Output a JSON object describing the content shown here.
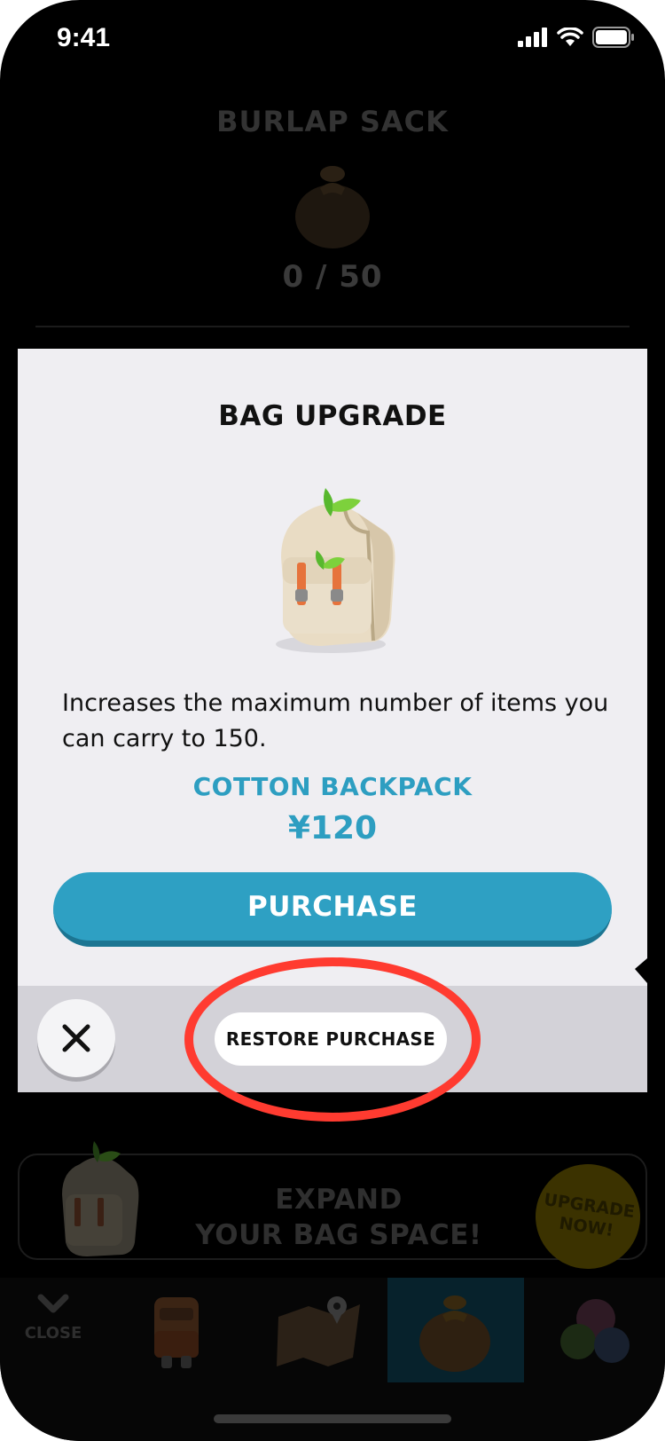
{
  "status_bar": {
    "time": "9:41"
  },
  "background": {
    "bag_name": "BURLAP SACK",
    "bag_count": "0 / 50"
  },
  "modal": {
    "title": "BAG UPGRADE",
    "description": "Increases the maximum number of items you can carry to 150.",
    "product_name": "COTTON BACKPACK",
    "price": "¥120",
    "purchase_label": "PURCHASE",
    "restore_label": "RESTORE PURCHASE",
    "close_icon": "close-icon"
  },
  "promo": {
    "line1": "EXPAND",
    "line2": "YOUR BAG SPACE!",
    "badge_line1": "UPGRADE",
    "badge_line2": "NOW!"
  },
  "tabbar": {
    "close_label": "CLOSE",
    "tabs": [
      "character-icon",
      "map-icon",
      "sack-icon",
      "creatures-icon"
    ],
    "active_tab": 2
  },
  "colors": {
    "accent": "#2ea0c3",
    "highlight": "#ff3b30",
    "modal_bg": "#efeef2",
    "footer_bg": "#d3d2d8"
  }
}
